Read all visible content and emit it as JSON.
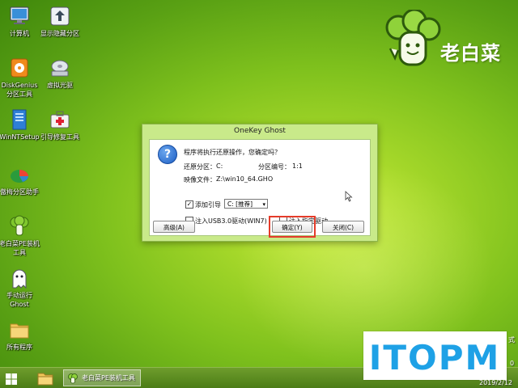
{
  "desktop": {
    "icons": [
      {
        "label": "计算机",
        "icon": "computer-icon"
      },
      {
        "label": "显示隐藏分区",
        "icon": "partition-toggle-icon"
      },
      {
        "label": "DiskGenius\n分区工具",
        "icon": "diskgenius-icon"
      },
      {
        "label": "虚拟光驱",
        "icon": "virtual-drive-icon"
      },
      {
        "label": "WinNTSetup",
        "icon": "winntsetup-icon"
      },
      {
        "label": "引导修复工具",
        "icon": "boot-repair-icon"
      },
      {
        "label": "傲梅分区助手",
        "icon": "aomei-partition-icon"
      },
      {
        "label": "老白菜PE装机\n工具",
        "icon": "pe-installer-icon"
      },
      {
        "label": "手动运行\nGhost",
        "icon": "ghost-icon"
      },
      {
        "label": "所有程序",
        "icon": "folder-icon"
      }
    ]
  },
  "logo": {
    "text": "老白菜"
  },
  "dialog": {
    "title": "OneKey Ghost",
    "question": "程序将执行还原操作，您确定吗？",
    "restore_partition_label": "还原分区：",
    "restore_partition_value": "C:",
    "partition_number_label": "分区编号：",
    "partition_number_value": "1:1",
    "image_file_label": "映像文件：",
    "image_file_value": "Z:\\win10_64.GHO",
    "add_boot_label": "添加引导",
    "add_boot_checked": true,
    "boot_select_value": "C: [推荐]",
    "usb_driver_label": "注入USB3.0驱动(WIN7)",
    "usb_driver_checked": false,
    "specific_driver_label": "注入指定驱动",
    "specific_driver_checked": false,
    "advanced_button": "高级(A)",
    "ok_button": "确定(Y)",
    "close_button": "关闭(C)"
  },
  "taskbar": {
    "task_label": "老白菜PE装机工具",
    "tray_fragment_1": "式",
    "tray_fragment_2": "0",
    "date": "2019/2/12"
  },
  "watermark": {
    "text": "ITOPM"
  },
  "colors": {
    "highlight": "#e53c2a",
    "watermark_blue": "#1ea1e6",
    "dialog_frame": "#c9ea8a"
  }
}
